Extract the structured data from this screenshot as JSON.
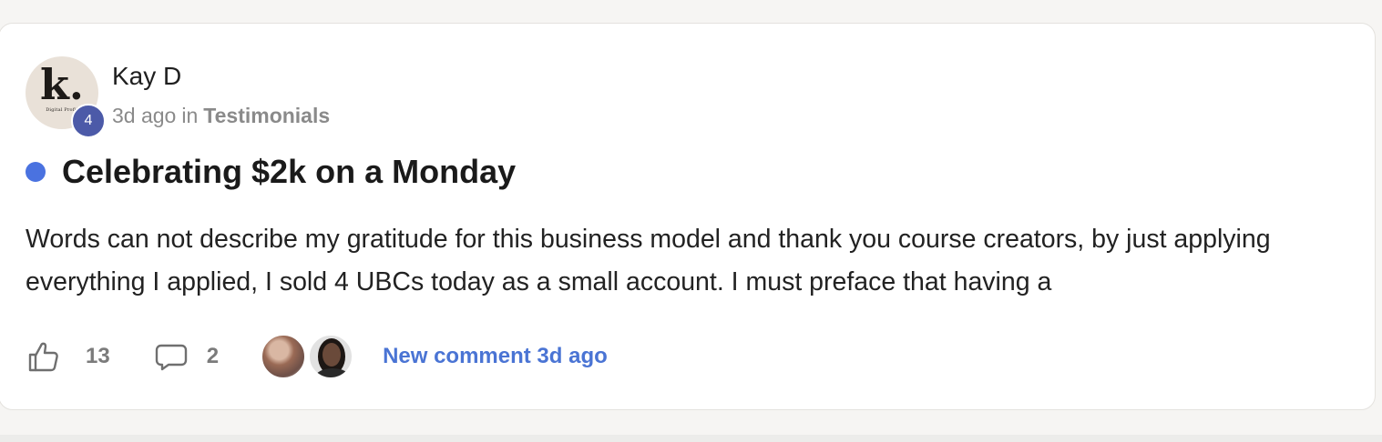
{
  "post": {
    "author": {
      "name": "Kay D",
      "avatar_letter": "k.",
      "avatar_tagline": "Digital Profit",
      "level": "4"
    },
    "time_ago": "3d ago",
    "in_label": "in",
    "category": "Testimonials",
    "unread": true,
    "title": "Celebrating $2k on a Monday",
    "body": "Words can not describe my gratitude for this business model and thank you course creators, by just applying everything I applied, I sold 4 UBCs today as a small account. I must preface that having a",
    "likes": "13",
    "comments": "2",
    "commenter_avatars": [
      "commenter-1",
      "commenter-2"
    ],
    "new_comment_label": "New comment 3d ago"
  },
  "colors": {
    "unread_dot": "#4a72e0",
    "level_badge": "#4c5aa8",
    "link": "#4a74d4",
    "muted": "#8a8a8a"
  },
  "icons": {
    "like": "thumbs-up-icon",
    "comment": "speech-bubble-icon"
  }
}
